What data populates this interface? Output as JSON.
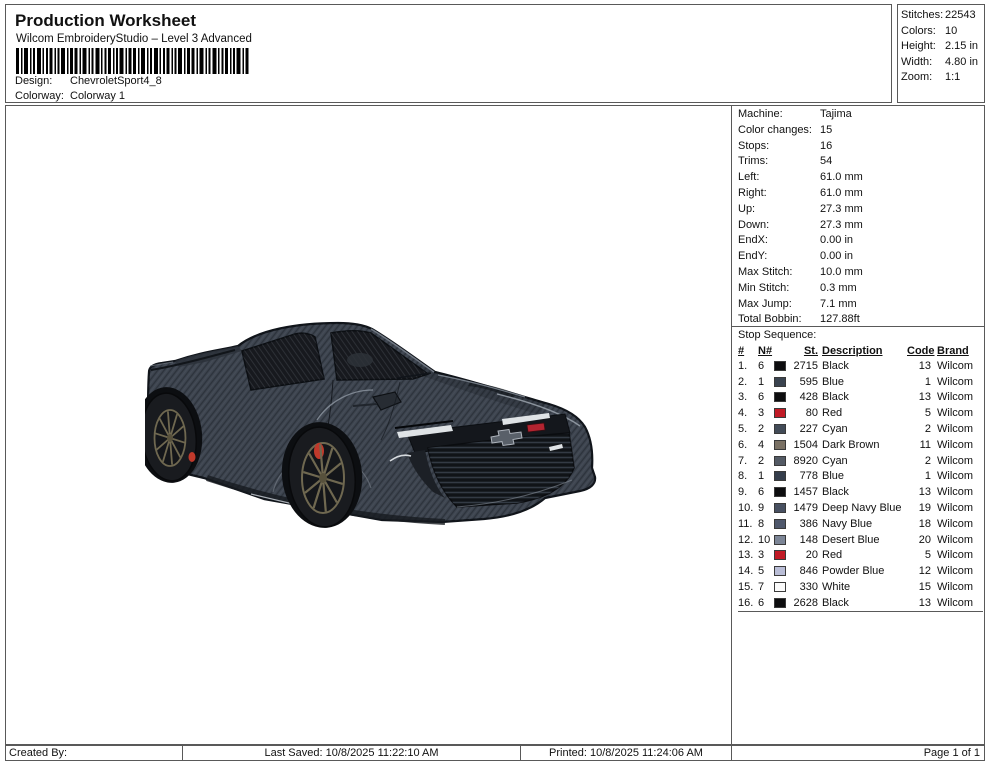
{
  "header": {
    "title": "Production Worksheet",
    "subtitle": "Wilcom EmbroideryStudio – Level 3 Advanced",
    "design_label": "Design:",
    "design_value": "ChevroletSport4_8",
    "colorway_label": "Colorway:",
    "colorway_value": "Colorway 1"
  },
  "summary": {
    "rows": [
      {
        "label": "Stitches:",
        "value": "22543"
      },
      {
        "label": "Colors:",
        "value": "10"
      },
      {
        "label": "Height:",
        "value": "2.15 in"
      },
      {
        "label": "Width:",
        "value": "4.80 in"
      },
      {
        "label": "Zoom:",
        "value": "1:1"
      }
    ]
  },
  "machine_info": {
    "rows": [
      {
        "label": "Machine:",
        "value": "Tajima"
      },
      {
        "label": "Color changes:",
        "value": "15"
      },
      {
        "label": "Stops:",
        "value": "16"
      },
      {
        "label": "Trims:",
        "value": "54"
      },
      {
        "label": "Left:",
        "value": "61.0 mm"
      },
      {
        "label": "Right:",
        "value": "61.0 mm"
      },
      {
        "label": "Up:",
        "value": "27.3 mm"
      },
      {
        "label": "Down:",
        "value": "27.3 mm"
      },
      {
        "label": "EndX:",
        "value": "0.00 in"
      },
      {
        "label": "EndY:",
        "value": "0.00 in"
      },
      {
        "label": "Max Stitch:",
        "value": "10.0 mm"
      },
      {
        "label": "Min Stitch:",
        "value": "0.3 mm"
      },
      {
        "label": "Max Jump:",
        "value": "7.1 mm"
      },
      {
        "label": "Total Bobbin:",
        "value": "127.88ft"
      }
    ]
  },
  "stop_sequence": {
    "section_label": "Stop Sequence:",
    "columns": {
      "num": "#",
      "n": "N#",
      "st": "St.",
      "description": "Description",
      "code": "Code",
      "brand": "Brand"
    },
    "rows": [
      {
        "num": "1.",
        "n": "6",
        "st": "2715",
        "description": "Black",
        "code": "13",
        "brand": "Wilcom",
        "swatch": "#0d0d0f"
      },
      {
        "num": "2.",
        "n": "1",
        "st": "595",
        "description": "Blue",
        "code": "1",
        "brand": "Wilcom",
        "swatch": "#3a434f"
      },
      {
        "num": "3.",
        "n": "6",
        "st": "428",
        "description": "Black",
        "code": "13",
        "brand": "Wilcom",
        "swatch": "#0d0d0f"
      },
      {
        "num": "4.",
        "n": "3",
        "st": "80",
        "description": "Red",
        "code": "5",
        "brand": "Wilcom",
        "swatch": "#c11a26"
      },
      {
        "num": "5.",
        "n": "2",
        "st": "227",
        "description": "Cyan",
        "code": "2",
        "brand": "Wilcom",
        "swatch": "#424b57"
      },
      {
        "num": "6.",
        "n": "4",
        "st": "1504",
        "description": "Dark Brown",
        "code": "11",
        "brand": "Wilcom",
        "swatch": "#7a7164"
      },
      {
        "num": "7.",
        "n": "2",
        "st": "8920",
        "description": "Cyan",
        "code": "2",
        "brand": "Wilcom",
        "swatch": "#535a64"
      },
      {
        "num": "8.",
        "n": "1",
        "st": "778",
        "description": "Blue",
        "code": "1",
        "brand": "Wilcom",
        "swatch": "#343d4b"
      },
      {
        "num": "9.",
        "n": "6",
        "st": "1457",
        "description": "Black",
        "code": "13",
        "brand": "Wilcom",
        "swatch": "#0d0d0f"
      },
      {
        "num": "10.",
        "n": "9",
        "st": "1479",
        "description": "Deep Navy Blue",
        "code": "19",
        "brand": "Wilcom",
        "swatch": "#485061"
      },
      {
        "num": "11.",
        "n": "8",
        "st": "386",
        "description": "Navy Blue",
        "code": "18",
        "brand": "Wilcom",
        "swatch": "#4f586c"
      },
      {
        "num": "12.",
        "n": "10",
        "st": "148",
        "description": "Desert Blue",
        "code": "20",
        "brand": "Wilcom",
        "swatch": "#7c8596"
      },
      {
        "num": "13.",
        "n": "3",
        "st": "20",
        "description": "Red",
        "code": "5",
        "brand": "Wilcom",
        "swatch": "#c11a26"
      },
      {
        "num": "14.",
        "n": "5",
        "st": "846",
        "description": "Powder Blue",
        "code": "12",
        "brand": "Wilcom",
        "swatch": "#b9bdd6"
      },
      {
        "num": "15.",
        "n": "7",
        "st": "330",
        "description": "White",
        "code": "15",
        "brand": "Wilcom",
        "swatch": "#fbfbfb"
      },
      {
        "num": "16.",
        "n": "6",
        "st": "2628",
        "description": "Black",
        "code": "13",
        "brand": "Wilcom",
        "swatch": "#0d0d0f"
      }
    ]
  },
  "artwork": {
    "subject": "Chevrolet Camaro embroidery design, front three-quarter view",
    "colors": {
      "body": "#3e4550",
      "body_shade": "#2b313a",
      "outline": "#10141a",
      "window": "#17191e",
      "grille": "#101317",
      "rim": "#6f6850",
      "tire": "#191b1f",
      "wheel_well": "#0c0e11",
      "caliper": "#c0392b",
      "highlight": "#dfe3e6",
      "badge_red": "#b32430",
      "bowtie": "#596069"
    }
  },
  "footer": {
    "created_by": "Created By:",
    "last_saved": "Last Saved: 10/8/2025 11:22:10 AM",
    "printed": "Printed: 10/8/2025 11:24:06 AM",
    "page": "Page 1 of 1"
  }
}
